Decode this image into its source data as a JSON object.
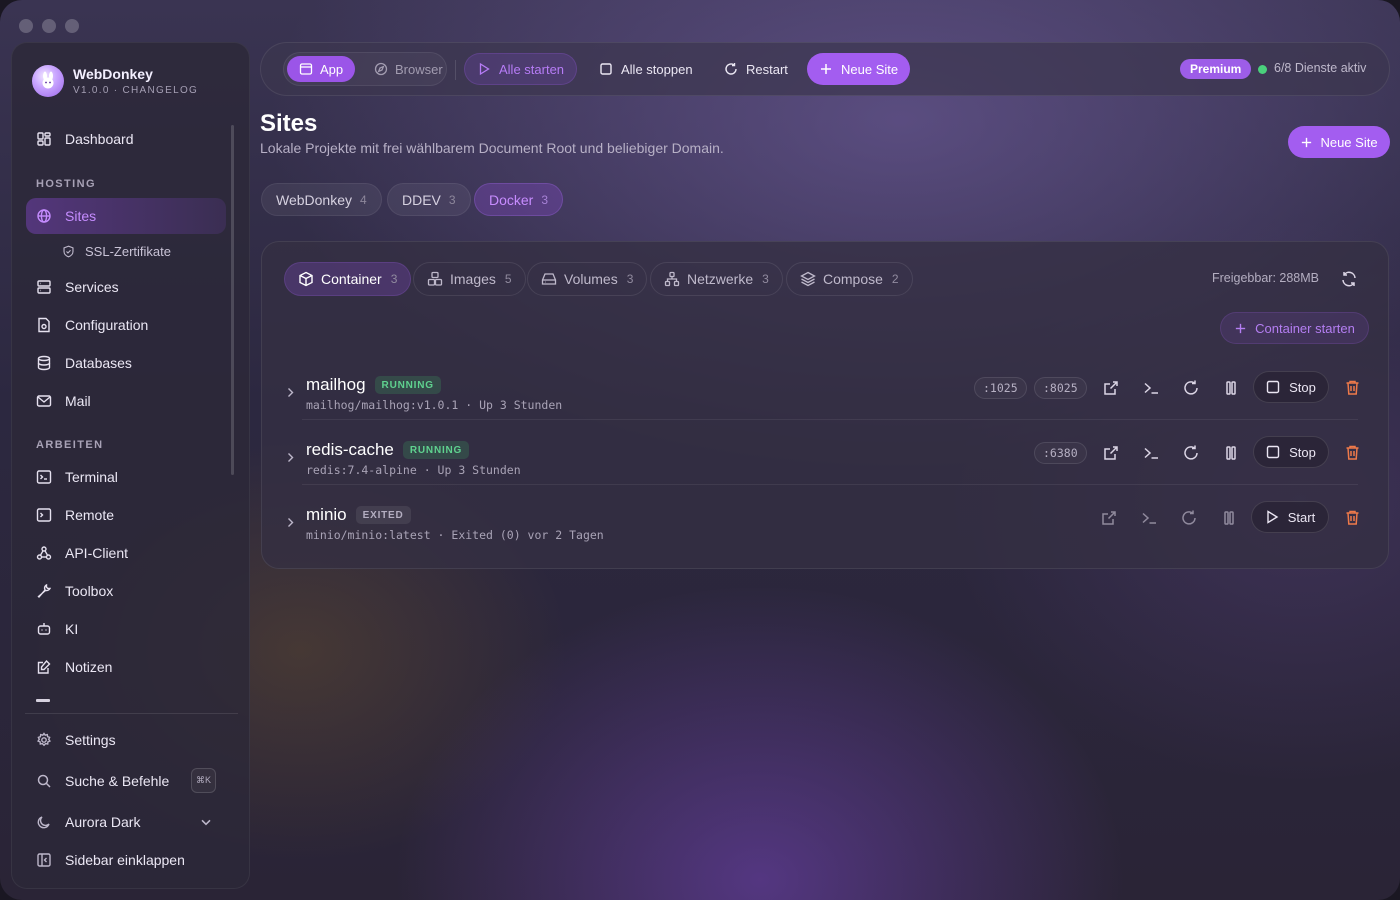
{
  "app": {
    "name": "WebDonkey",
    "version_line": "V1.0.0 · CHANGELOG"
  },
  "sidebar": {
    "top_items": [
      {
        "label": "Dashboard",
        "icon": "dashboard-icon"
      }
    ],
    "hosting_label": "HOSTING",
    "hosting_items": [
      {
        "label": "Sites",
        "icon": "globe-icon",
        "active": true
      },
      {
        "label": "SSL-Zertifikate",
        "icon": "shield-icon",
        "sub": true
      },
      {
        "label": "Services",
        "icon": "server-icon"
      },
      {
        "label": "Configuration",
        "icon": "config-file-icon"
      },
      {
        "label": "Databases",
        "icon": "database-icon"
      },
      {
        "label": "Mail",
        "icon": "mail-icon"
      }
    ],
    "arbeiten_label": "ARBEITEN",
    "arbeiten_items": [
      {
        "label": "Terminal",
        "icon": "terminal-icon"
      },
      {
        "label": "Remote",
        "icon": "remote-terminal-icon"
      },
      {
        "label": "API-Client",
        "icon": "webhook-icon"
      },
      {
        "label": "Toolbox",
        "icon": "wrench-icon"
      },
      {
        "label": "KI",
        "icon": "bot-icon"
      },
      {
        "label": "Notizen",
        "icon": "note-edit-icon"
      }
    ],
    "bottom_items": {
      "settings": "Settings",
      "search": "Suche & Befehle",
      "search_shortcut": "⌘K",
      "theme": "Aurora Dark",
      "collapse": "Sidebar einklappen"
    }
  },
  "toolbar": {
    "mode_app": "App",
    "mode_browser": "Browser",
    "start_all": "Alle starten",
    "stop_all": "Alle stoppen",
    "restart": "Restart",
    "new_site": "Neue Site",
    "premium": "Premium",
    "services_status": "6/8 Dienste aktiv"
  },
  "page": {
    "title": "Sites",
    "subtitle": "Lokale Projekte mit frei wählbarem Document Root und beliebiger Domain.",
    "new_site": "Neue Site",
    "tabs": [
      {
        "label": "WebDonkey",
        "count": "4"
      },
      {
        "label": "DDEV",
        "count": "3"
      },
      {
        "label": "Docker",
        "count": "3",
        "active": true
      }
    ]
  },
  "docker": {
    "subtabs": [
      {
        "label": "Container",
        "count": "3",
        "icon": "box-icon",
        "active": true
      },
      {
        "label": "Images",
        "count": "5",
        "icon": "layers-boxes-icon"
      },
      {
        "label": "Volumes",
        "count": "3",
        "icon": "hard-drive-icon"
      },
      {
        "label": "Netzwerke",
        "count": "3",
        "icon": "network-icon"
      },
      {
        "label": "Compose",
        "count": "2",
        "icon": "stack-icon"
      }
    ],
    "reclaimable": "Freigebbar: 288MB",
    "start_container": "Container starten",
    "containers": [
      {
        "name": "mailhog",
        "status": "RUNNING",
        "meta": "mailhog/mailhog:v1.0.1 · Up 3 Stunden",
        "ports": [
          ":1025",
          ":8025"
        ],
        "action": "Stop"
      },
      {
        "name": "redis-cache",
        "status": "RUNNING",
        "meta": "redis:7.4-alpine · Up 3 Stunden",
        "ports": [
          ":6380"
        ],
        "action": "Stop"
      },
      {
        "name": "minio",
        "status": "EXITED",
        "meta": "minio/minio:latest · Exited (0) vor 2 Tagen",
        "ports": [],
        "action": "Start"
      }
    ]
  },
  "colors": {
    "accent": "#a35df0",
    "running": "#5fd28f",
    "danger": "#ef7a4a"
  }
}
